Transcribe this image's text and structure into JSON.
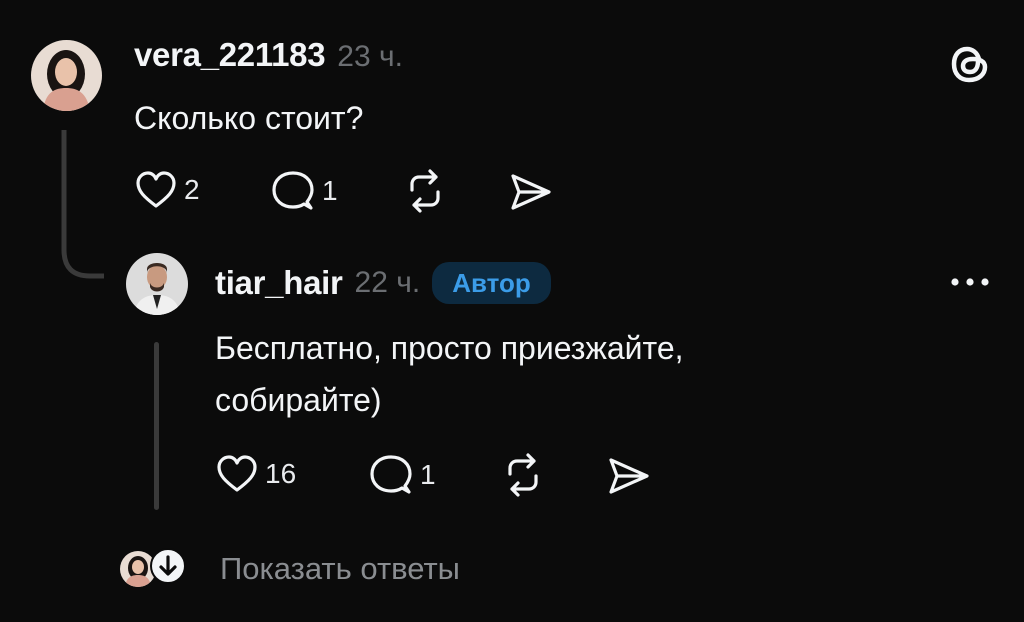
{
  "top_comment": {
    "username": "vera_221183",
    "time": "23 ч.",
    "text": "Сколько стоит?",
    "likes": "2",
    "replies": "1"
  },
  "reply": {
    "username": "tiar_hair",
    "time": "22 ч.",
    "badge": "Автор",
    "text_line1": "Бесплатно, просто приезжайте,",
    "text_line2": "собирайте)",
    "likes": "16",
    "replies": "1"
  },
  "footer": {
    "show_replies_label": "Показать ответы"
  },
  "icons": {
    "app": "threads-logo-icon",
    "more": "more-dots-icon",
    "like": "heart-icon",
    "comment": "comment-bubble-icon",
    "repost": "repost-icon",
    "share": "send-icon",
    "expand": "arrow-down-icon"
  },
  "colors": {
    "background": "#0b0b0b",
    "text": "#f3f5f7",
    "muted": "#6b6e72",
    "badge_bg": "#0d2a40",
    "badge_text": "#3b9ce8"
  }
}
